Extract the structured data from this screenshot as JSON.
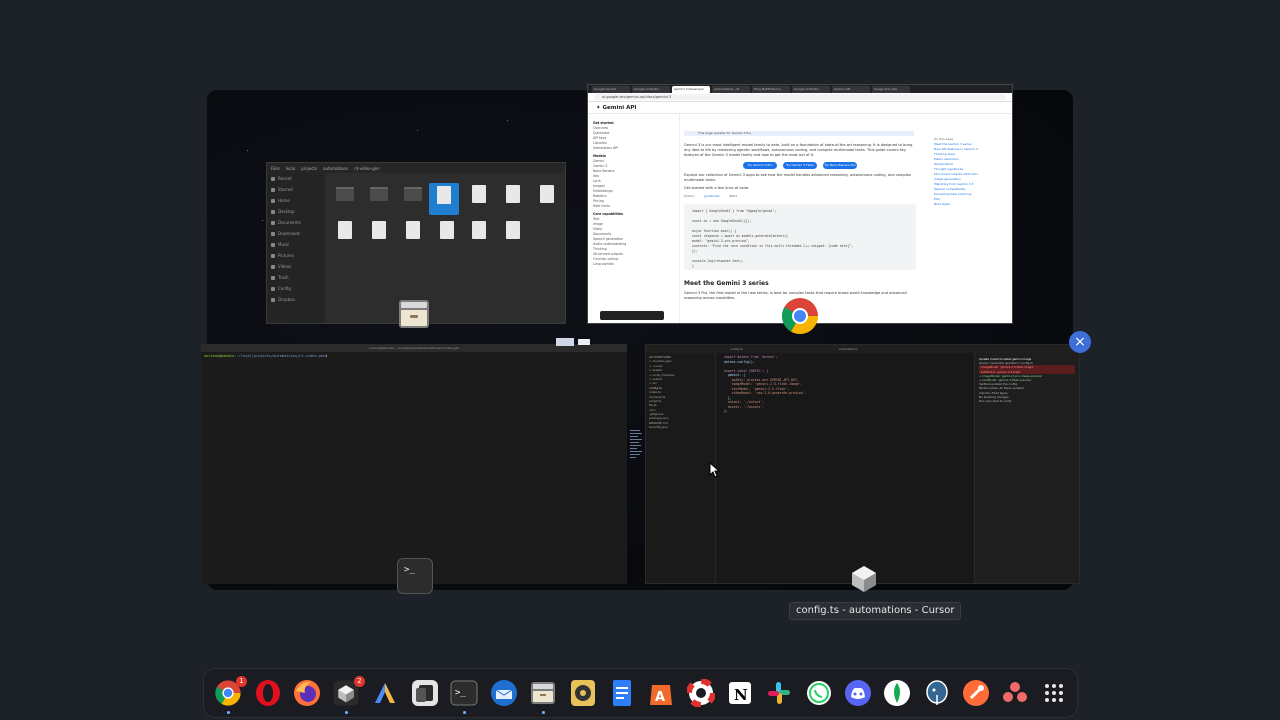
{
  "overview": {
    "hover_tooltip": "config.ts - automations - Cursor",
    "close_glyph": "×"
  },
  "files_window": {
    "title": "Files",
    "path": [
      "local",
      "projects",
      "automations",
      "nt-video-gen"
    ],
    "sidebar": [
      "Recent",
      "Starred",
      "Home",
      "Desktop",
      "Documents",
      "Downloads",
      "Music",
      "Pictures",
      "Videos",
      "Trash",
      "Config",
      "Dropbox"
    ]
  },
  "chrome_window": {
    "tabs": [
      "Google Gemini",
      "Google AI Studio",
      "Gemini 3 Developer",
      "Automations – fe",
      "Ding Notifications",
      "Google AI Studio",
      "Gemini API",
      "Usage and rate"
    ],
    "url": "ai.google.dev/gemini-api/docs/gemini-3",
    "brand": "✦ Gemini API",
    "banner": "This page updates for Gemini 3 Pro.",
    "nav_items": [
      "Get started",
      "Overview",
      "Quickstart",
      "API keys",
      "Libraries",
      "Interactions API",
      "Models",
      "Gemini",
      "Gemini 3",
      "Nano Banana",
      "Veo",
      "Lyria",
      "Imagen",
      "Embeddings",
      "Robotics",
      "Pricing",
      "Rate limits",
      "Core capabilities",
      "Text",
      "Image",
      "Video",
      "Documents",
      "Speech generation",
      "Audio understanding",
      "Thinking",
      "Structured outputs",
      "Function calling",
      "Long context"
    ],
    "intro": "Gemini 3 is our most intelligent model family to date, built on a foundation of state-of-the-art reasoning. It is designed to bring any idea to life by mastering agentic workflows, autonomous coding, and complex multimodal tasks. This guide covers key features of the Gemini 3 model family and how to get the most out of it.",
    "buttons": [
      "Try Gemini 3 Pro",
      "Try Gemini 3 Flash",
      "Try Nano Banana Pro"
    ],
    "explore": "Explore our collection of Gemini 3 apps to see how the model handles advanced reasoning, autonomous coding, and complex multimodal tasks.",
    "get_started": "Get started with a few lines of code:",
    "code_tabs": [
      "Python",
      "JavaScript",
      "REST"
    ],
    "code": [
      "import { GoogleGenAI } from \"@google/genai\";",
      "",
      "const ai = new GoogleGenAI({});",
      "",
      "async function main() {",
      "  const response = await ai.models.generateContent({",
      "    model: \"gemini-3-pro-preview\",",
      "    contents: \"Find the race condition in this multi-threaded C++ snippet: [code here]\",",
      "  });",
      "",
      "  console.log(response.text);",
      "}",
      "",
      "main();"
    ],
    "section": "Meet the Gemini 3 series",
    "section_text": "Gemini 3 Pro, the first model in the new series, is best for complex tasks that require broad world knowledge and advanced reasoning across modalities.",
    "toc": [
      "On this page",
      "Meet the Gemini 3 series",
      "New API features in Gemini 3",
      "Thinking level",
      "Media resolution",
      "Temperature",
      "Thought signatures",
      "Structured outputs with tools",
      "Image generation",
      "Migrating from Gemini 2.5",
      "OpenAI compatibility",
      "Prompting best practices",
      "FAQ",
      "Next steps"
    ]
  },
  "terminal_window": {
    "title": "nucleus@ubuntu: ~/local/projects/automations/nt-video-gen",
    "prompt_user": "nucleus@ubuntu",
    "prompt_path": ":~/local/projects/automations/nt-video-gen",
    "prompt_symbol": "$"
  },
  "cursor_window": {
    "title": "automations",
    "tab": "config.ts",
    "explorer": [
      "AUTOMATIONS",
      "> nt-video-gen",
      "> .cursor",
      "> assets",
      "> node_modules",
      "> output",
      "> src",
      "  config.ts",
      "  index.ts",
      "  renderer.ts",
      "  script.ts",
      "  tts.ts",
      "  .env",
      "  .gitignore",
      "  package.json",
      "  README.md",
      "  tsconfig.json"
    ],
    "code": [
      "import dotenv from 'dotenv';",
      "dotenv.config();",
      "",
      "export const CONFIG = {",
      "  gemini: {",
      "    apiKey: process.env.GEMINI_API_KEY,",
      "    imageModel: 'gemini-2.5-flash-image',",
      "    textModel: 'gemini-2.5-flash',",
      "    videoModel: 'veo-3.0-generate-preview',",
      "  },",
      "  output: './output',",
      "  assets: './assets',",
      "};"
    ],
    "chat": [
      "Update model to latest gemini image",
      "Gemini model IDs updated in config.ts",
      "- imageModel: 'gemini-2.5-flash-image'",
      "- textModel: 'gemini-2.5-flash'",
      "+ imageModel: 'gemini-3-pro-image-preview'",
      "+ textModel: 'gemini-3-flash-preview'",
      "Verified updated the config:",
      "Model names: All fields updated",
      "Imports: Fixed types",
      "No breaking changes",
      "Run npm start to verify"
    ]
  },
  "dock": {
    "apps": [
      {
        "name": "chrome-icon",
        "badge": "1",
        "running": true
      },
      {
        "name": "opera-icon",
        "running": false
      },
      {
        "name": "firefox-icon",
        "running": false
      },
      {
        "name": "cursor-icon",
        "badge": "2",
        "running": true
      },
      {
        "name": "antigravity-icon",
        "running": false
      },
      {
        "name": "notion-like-icon",
        "running": false
      },
      {
        "name": "terminal-icon",
        "running": true
      },
      {
        "name": "thunderbird-icon",
        "running": false
      },
      {
        "name": "files-icon",
        "running": true
      },
      {
        "name": "rhythmbox-icon",
        "running": false
      },
      {
        "name": "docs-icon",
        "running": false
      },
      {
        "name": "app-center-icon",
        "running": false
      },
      {
        "name": "help-icon",
        "running": false
      },
      {
        "name": "notion-icon",
        "running": false
      },
      {
        "name": "slack-icon",
        "running": false
      },
      {
        "name": "whatsapp-icon",
        "running": false
      },
      {
        "name": "discord-icon",
        "running": false
      },
      {
        "name": "mongodb-icon",
        "running": false
      },
      {
        "name": "postgres-icon",
        "running": false
      },
      {
        "name": "postman-icon",
        "running": false
      },
      {
        "name": "asana-icon",
        "running": false
      },
      {
        "name": "app-grid-icon",
        "running": false
      }
    ]
  }
}
